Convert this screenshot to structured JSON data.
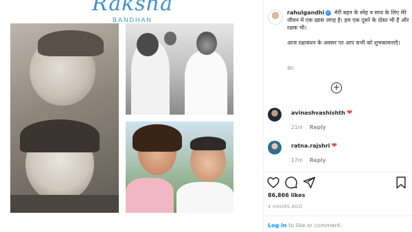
{
  "media": {
    "brand_script": "Raksha",
    "brand_subtitle": "BANDHAN"
  },
  "post": {
    "author": {
      "username": "rahulgandhi",
      "verified_icon": "verified-badge-icon"
    },
    "caption_lines": [
      "मेरी बहन के स्नेह व साथ के लिए मेरे जीवन में एक ख़ास जगह है। हम एक दूसरे के दोस्त भी हैं और रक्षक भी।",
      "आज रक्षाबंधन के अवसर पर आप सभी को शुभकामनाएँ।"
    ],
    "caption_age": "4h",
    "load_more_icon": "plus-circle-icon",
    "comments": [
      {
        "username": "avinashvashishth",
        "age": "21m",
        "reply_label": "Reply",
        "emoji_icon": "red-heart-emoji"
      },
      {
        "username": "ratna.rajshri",
        "age": "17m",
        "reply_label": "Reply",
        "emoji_icon": "red-heart-emoji"
      }
    ],
    "actions": {
      "like_icon": "heart-outline-icon",
      "comment_icon": "comment-bubble-icon",
      "share_icon": "paper-plane-icon",
      "save_icon": "bookmark-icon"
    },
    "likes_text": "86,866 likes",
    "posted_time": "4 HOURS AGO",
    "login_link": "Log in",
    "login_rest": " to like or comment."
  },
  "colors": {
    "verified": "#3897f0",
    "heart": "#ed4956",
    "link": "#0095f6",
    "muted": "#8e8e8e",
    "brand": "#3f8fcf"
  }
}
